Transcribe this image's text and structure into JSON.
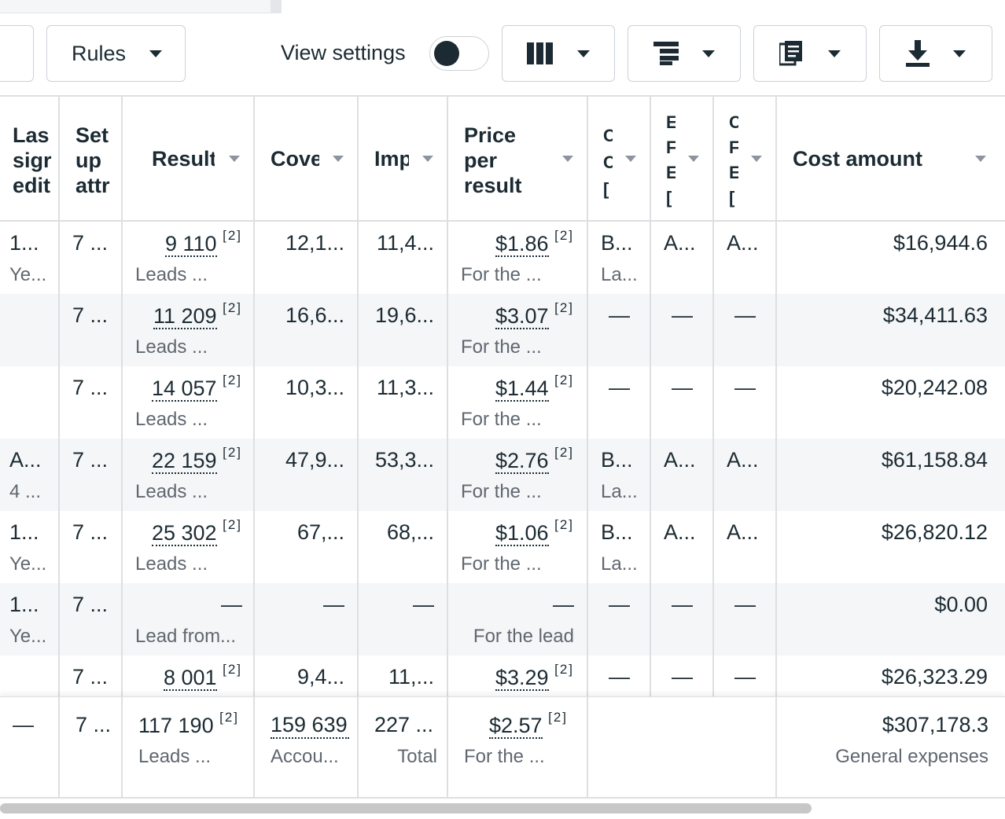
{
  "toolbar": {
    "rules_label": "Rules",
    "view_settings_label": "View settings",
    "view_settings_on": false
  },
  "columns": {
    "last_significant_edit": "Las\nsigr\nedit",
    "setup_attribution": "Set\nup\nattr",
    "results": "Result",
    "coverage": "Cove",
    "impressions": "Imp",
    "price_per_result": "Price\nper\nresult",
    "c1": "C\nC\n[",
    "c2": "E\nF\nE\n[",
    "c3": "C\nF\nE\n[",
    "cost_amount": "Cost amount"
  },
  "rows": [
    {
      "edit": "1...",
      "edit_sub": "Ye...",
      "setup": "7 ...",
      "result": "9 110",
      "result_note": "[2]",
      "result_sub": "Leads ...",
      "cov": "12,1...",
      "imp": "11,4...",
      "price": "$1.86",
      "price_note": "[2]",
      "price_sub": "For the ...",
      "c1": "B...",
      "c1_sub": "La...",
      "c2": "A...",
      "c3": "A...",
      "cost": "$16,944.6"
    },
    {
      "edit": "",
      "edit_sub": "",
      "setup": "7 ...",
      "result": "11 209",
      "result_note": "[2]",
      "result_sub": "Leads ...",
      "cov": "16,6...",
      "imp": "19,6...",
      "price": "$3.07",
      "price_note": "[2]",
      "price_sub": "For the ...",
      "c1": "—",
      "c1_sub": "",
      "c2": "—",
      "c3": "—",
      "cost": "$34,411.63"
    },
    {
      "edit": "",
      "edit_sub": "",
      "setup": "7 ...",
      "result": "14 057",
      "result_note": "[2]",
      "result_sub": "Leads ...",
      "cov": "10,3...",
      "imp": "11,3...",
      "price": "$1.44",
      "price_note": "[2]",
      "price_sub": "For the ...",
      "c1": "—",
      "c1_sub": "",
      "c2": "—",
      "c3": "—",
      "cost": "$20,242.08"
    },
    {
      "edit": "A...",
      "edit_sub": "4 ...",
      "setup": "7 ...",
      "result": "22 159",
      "result_note": "[2]",
      "result_sub": "Leads ...",
      "cov": "47,9...",
      "imp": "53,3...",
      "price": "$2.76",
      "price_note": "[2]",
      "price_sub": "For the ...",
      "c1": "B...",
      "c1_sub": "La...",
      "c2": "A...",
      "c3": "A...",
      "cost": "$61,158.84"
    },
    {
      "edit": "1...",
      "edit_sub": "Ye...",
      "setup": "7 ...",
      "result": "25 302",
      "result_note": "[2]",
      "result_sub": "Leads ...",
      "cov": "67,...",
      "imp": "68,...",
      "price": "$1.06",
      "price_note": "[2]",
      "price_sub": "For the ...",
      "c1": "B...",
      "c1_sub": "La...",
      "c2": "A...",
      "c3": "A...",
      "cost": "$26,820.12"
    },
    {
      "edit": "1...",
      "edit_sub": "Ye...",
      "setup": "7 ...",
      "result": "—",
      "result_note": "",
      "result_sub": "Lead from...",
      "cov": "—",
      "imp": "—",
      "price": "—",
      "price_note": "",
      "price_sub": "For the lead",
      "c1": "—",
      "c1_sub": "",
      "c2": "—",
      "c3": "—",
      "cost": "$0.00"
    },
    {
      "edit": "",
      "edit_sub": "",
      "setup": "7 ...",
      "result": "8 001",
      "result_note": "[2]",
      "result_sub": "",
      "cov": "9,4...",
      "imp": "11,...",
      "price": "$3.29",
      "price_note": "[2]",
      "price_sub": "",
      "c1": "—",
      "c1_sub": "",
      "c2": "—",
      "c3": "—",
      "cost": "$26,323.29"
    }
  ],
  "footer": {
    "edit": "—",
    "setup": "7 ...",
    "result": "117 190",
    "result_note": "[2]",
    "result_sub": "Leads ...",
    "cov": "159 639",
    "cov_sub": "Accou...",
    "imp": "227 ...",
    "imp_sub": "Total",
    "price": "$2.57",
    "price_note": "[2]",
    "price_sub": "For the ...",
    "cost": "$307,178.3",
    "cost_sub": "General expenses"
  }
}
